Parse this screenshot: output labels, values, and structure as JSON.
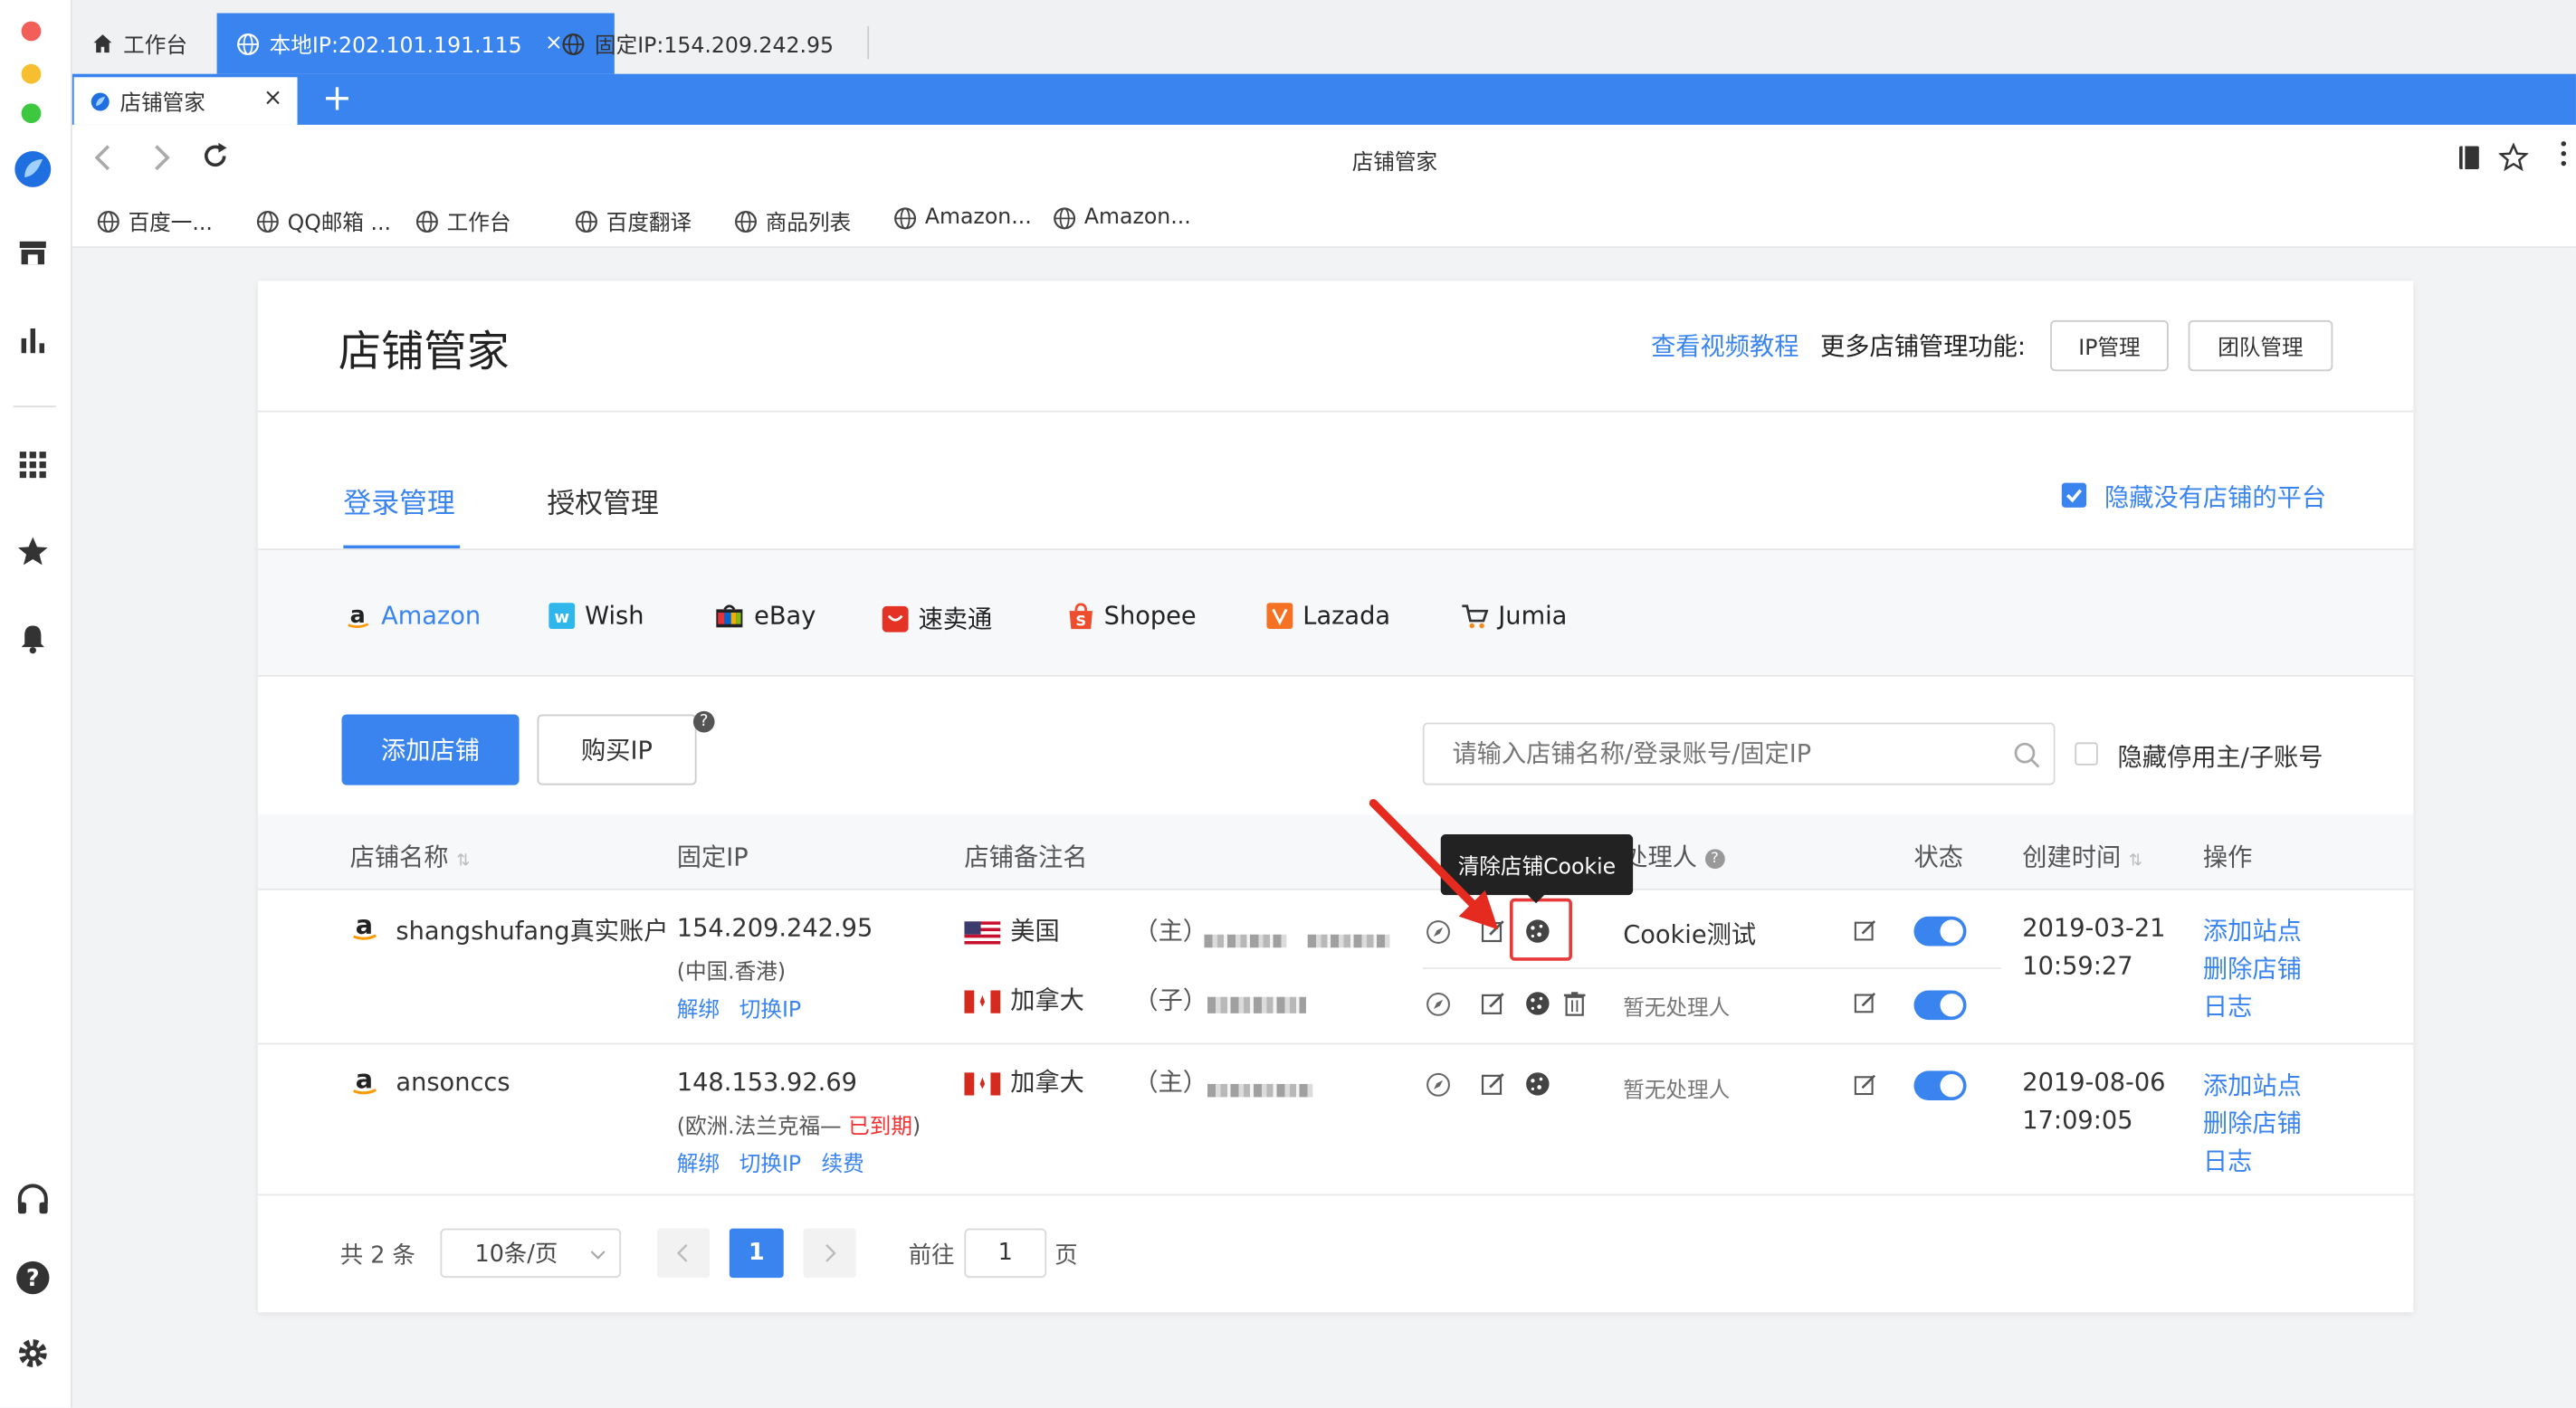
{
  "browser": {
    "top_tabs": [
      {
        "label": "工作台"
      },
      {
        "label": "本地IP:202.101.191.115"
      },
      {
        "label": "固定IP:154.209.242.95"
      }
    ],
    "page_tab": {
      "label": "店铺管家",
      "close": "×",
      "new": "+"
    },
    "address_title": "店铺管家",
    "bookmarks": [
      "百度一...",
      "QQ邮箱 ...",
      "工作台",
      "百度翻译",
      "商品列表",
      "Amazon...",
      "Amazon..."
    ]
  },
  "page": {
    "title": "店铺管家",
    "video_link": "查看视频教程",
    "more_label": "更多店铺管理功能:",
    "ip_btn": "IP管理",
    "team_btn": "团队管理",
    "tabs": [
      "登录管理",
      "授权管理"
    ],
    "hide_platforms": "隐藏没有店铺的平台",
    "platforms": [
      "Amazon",
      "Wish",
      "eBay",
      "速卖通",
      "Shopee",
      "Lazada",
      "Jumia"
    ],
    "add_btn": "添加店铺",
    "buy_btn": "购买IP",
    "search_placeholder": "请输入店铺名称/登录账号/固定IP",
    "hide_sub": "隐藏停用主/子账号",
    "tooltip": "清除店铺Cookie"
  },
  "table": {
    "headers": [
      "店铺名称",
      "固定IP",
      "店铺备注名",
      "处理人",
      "状态",
      "创建时间",
      "操作"
    ],
    "rows": [
      {
        "name": "shangshufang真实账户",
        "ip": "154.209.242.95",
        "loc": "(中国.香港)",
        "links": [
          "解绑",
          "切换IP"
        ],
        "subs": [
          {
            "country": "美国",
            "type": "（主）",
            "handler": "Cookie测试"
          },
          {
            "country": "加拿大",
            "type": "（子）",
            "handler": "暂无处理人"
          }
        ],
        "date": "2019-03-21",
        "time": "10:59:27",
        "ops": [
          "添加站点",
          "删除店铺",
          "日志"
        ]
      },
      {
        "name": "ansonccs",
        "ip": "148.153.92.69",
        "loc": "(欧洲.法兰克福— ",
        "expired": "已到期",
        "loc_end": ")",
        "links": [
          "解绑",
          "切换IP",
          "续费"
        ],
        "subs": [
          {
            "country": "加拿大",
            "type": "（主）",
            "handler": "暂无处理人"
          }
        ],
        "date": "2019-08-06",
        "time": "17:09:05",
        "ops": [
          "添加站点",
          "删除店铺",
          "日志"
        ]
      }
    ]
  },
  "pagination": {
    "total": "共 2 条",
    "page_size": "10条/页",
    "current": "1",
    "goto_label": "前往",
    "goto_value": "1",
    "page_unit": "页"
  },
  "colors": {
    "accent": "#3a84f0",
    "danger": "#f23030"
  }
}
